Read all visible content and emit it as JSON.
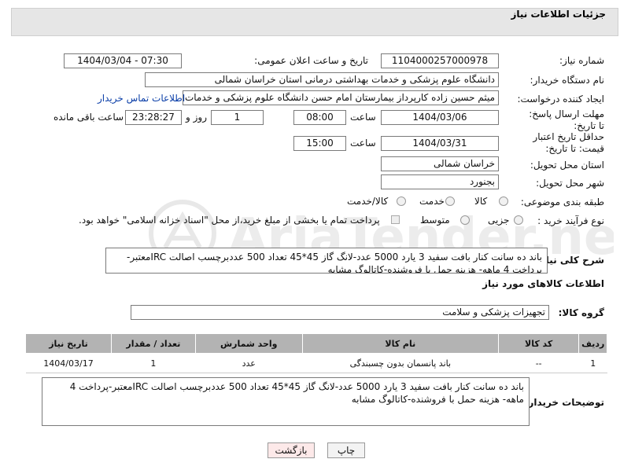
{
  "header": {
    "title": "جزئیات اطلاعات نیاز"
  },
  "form": {
    "need_number_label": "شماره نیاز:",
    "need_number": "1104000257000978",
    "announce_label": "تاریخ و ساعت اعلان عمومی:",
    "announce_value": "1404/03/04 - 07:30",
    "buyer_org_label": "نام دستگاه خریدار:",
    "buyer_org": "دانشگاه علوم پزشکی و خدمات بهداشتی درمانی استان خراسان شمالی",
    "creator_label": "ایجاد کننده درخواست:",
    "creator": "میثم  حسین زاده  کارپرداز بیمارستان امام حسن دانشگاه علوم پزشکی و خدمات",
    "contact_link": "اطلاعات تماس خریدار",
    "deadline_label": "مهلت ارسال پاسخ: تا تاریخ:",
    "deadline_date": "1404/03/06",
    "time_label": "ساعت",
    "deadline_time": "08:00",
    "days_value": "1",
    "days_label": "روز و",
    "remaining_value": "23:28:27",
    "remaining_label": "ساعت باقی مانده",
    "validity_label": "حداقل تاریخ اعتبار قیمت: تا تاریخ:",
    "validity_date": "1404/03/31",
    "validity_time": "15:00",
    "province_label": "استان محل تحویل:",
    "province": "خراسان شمالی",
    "city_label": "شهر محل تحویل:",
    "city": "بجنورد",
    "category_label": "طبقه بندی موضوعی:",
    "category_options": [
      "کالا",
      "خدمت",
      "کالا/خدمت"
    ],
    "process_label": "نوع فرآیند خرید :",
    "process_options": [
      "جزیی",
      "متوسط"
    ],
    "payment_note": "پرداخت تمام یا بخشی از مبلغ خرید،از محل \"اسناد خزانه اسلامی\" خواهد بود."
  },
  "description": {
    "label": "شرح کلی نیاز:",
    "text": "باند ده سانت کنار بافت سفید 3 یارد 5000 عدد-لانگ گاز 45*45 تعداد 500 عددبرچسب اصالت IRCمعتبر-پرداخت 4 ماهه- هزینه حمل با فروشنده-کاتالوگ مشابه"
  },
  "goods_section": {
    "title": "اطلاعات کالاهای مورد نیاز",
    "group_label": "گروه کالا:",
    "group_value": "تجهیزات پزشکی و سلامت"
  },
  "table": {
    "headers": [
      "ردیف",
      "کد کالا",
      "نام کالا",
      "واحد شمارش",
      "تعداد / مقدار",
      "تاریخ نیاز"
    ],
    "rows": [
      [
        "1",
        "--",
        "باند پانسمان بدون چسبندگی",
        "عدد",
        "1",
        "1404/03/17"
      ]
    ]
  },
  "buyer_notes": {
    "label": "توضیحات خریدار:",
    "text": "باند ده سانت کنار بافت سفید 3 یارد 5000 عدد-لانگ گاز 45*45 تعداد 500 عددبرچسب اصالت IRCمعتبر-پرداخت 4 ماهه- هزینه حمل با فروشنده-کاتالوگ مشابه"
  },
  "buttons": {
    "print": "چاپ",
    "back": "بازگشت"
  },
  "watermark": {
    "brand": "AriaTender.neT"
  },
  "colors": {
    "panel_bg": "#e6e6e6",
    "table_header": "#b3b3b3",
    "link": "#0a3ea8",
    "back_button_bg": "#fde9e9"
  }
}
